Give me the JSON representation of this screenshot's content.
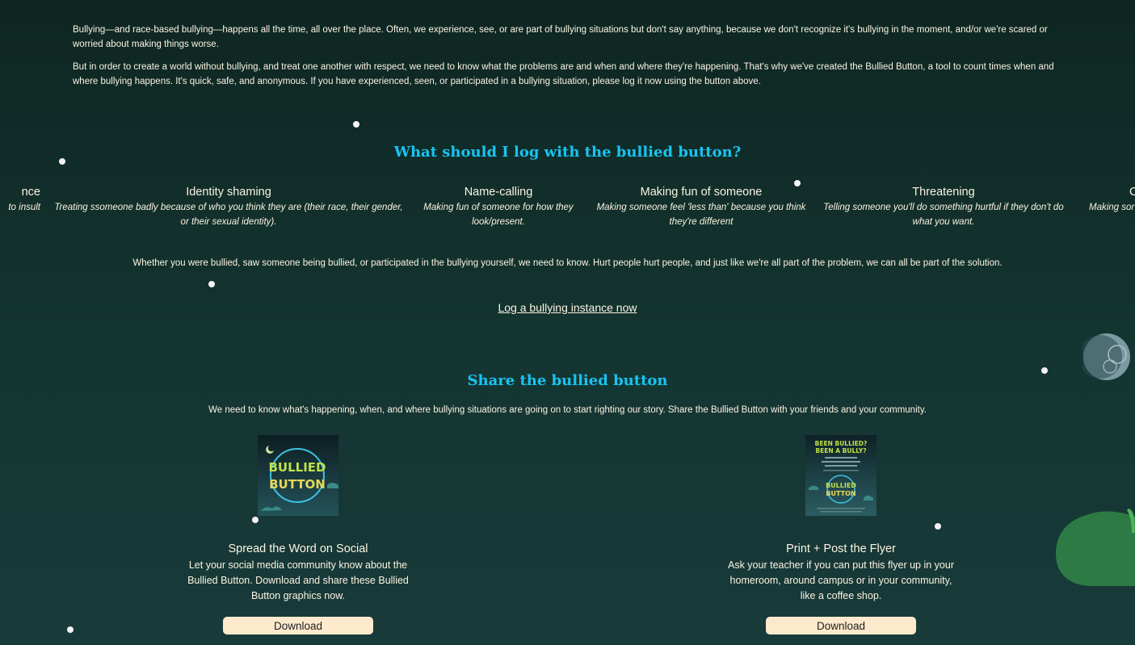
{
  "intro": {
    "p1": "Bullying—and race-based bullying—happens all the time, all over the place. Often, we experience, see, or are part of bullying situations but don't say anything, because we don't recognize it's bullying in the moment, and/or we're scared or worried about making things worse.",
    "p2": "But in order to create a world without bullying, and treat one another with respect, we need to know what the problems are and when and where they're happening. That's why we've created the Bullied Button, a tool to count times when and where bullying happens. It's quick, safe, and anonymous. If you have experienced, seen, or participated in a bullying situation, please log it now using the button above."
  },
  "log_section": {
    "heading": "What should I log with the bullied button?",
    "items": [
      {
        "title": "nce",
        "desc": "to insult"
      },
      {
        "title": "Identity shaming",
        "desc": "Treating ssomeone badly because of who you think they are (their race, their gender, or their sexual identity)."
      },
      {
        "title": "Name-calling",
        "desc": "Making fun of someone for how they look/present."
      },
      {
        "title": "Making fun of someone",
        "desc": "Making someone feel 'less than' because you think they're different"
      },
      {
        "title": "Threatening",
        "desc": "Telling someone you'll do something hurtful if they don't do what you want."
      },
      {
        "title": "C",
        "desc": "Making sor b"
      }
    ],
    "note": "Whether you were bullied, saw someone being bullied, or participated in the bullying yourself, we need to know. Hurt people hurt people, and just like we're all part of the problem, we can all be part of the solution.",
    "link": "Log a bullying instance now"
  },
  "share_section": {
    "heading": "Share the bullied button",
    "intro": "We need to know what's happening, when, and where bullying situations are going on to start righting our story. Share the Bullied Button with your friends and your community.",
    "cards": [
      {
        "title": "Spread the Word on Social",
        "desc": "Let your social media community know about the Bullied Button. Download and share these Bullied Button graphics now.",
        "button": "Download",
        "thumb_text": [
          "BULLIED",
          "BUTTON"
        ]
      },
      {
        "title": "Print + Post the Flyer",
        "desc": "Ask your teacher if you can put this flyer up in your homeroom, around campus or in your community, like a coffee shop.",
        "button": "Download",
        "thumb_text": [
          "BEEN BULLIED?",
          "BEEN A BULLY?",
          "BULLIED",
          "BUTTON"
        ]
      }
    ]
  },
  "colors": {
    "heading": "#18c4f2",
    "text": "#fbf4e2",
    "button_bg": "#fde9cc",
    "bg_top": "#0e2622",
    "bg_bottom": "#183a39"
  }
}
